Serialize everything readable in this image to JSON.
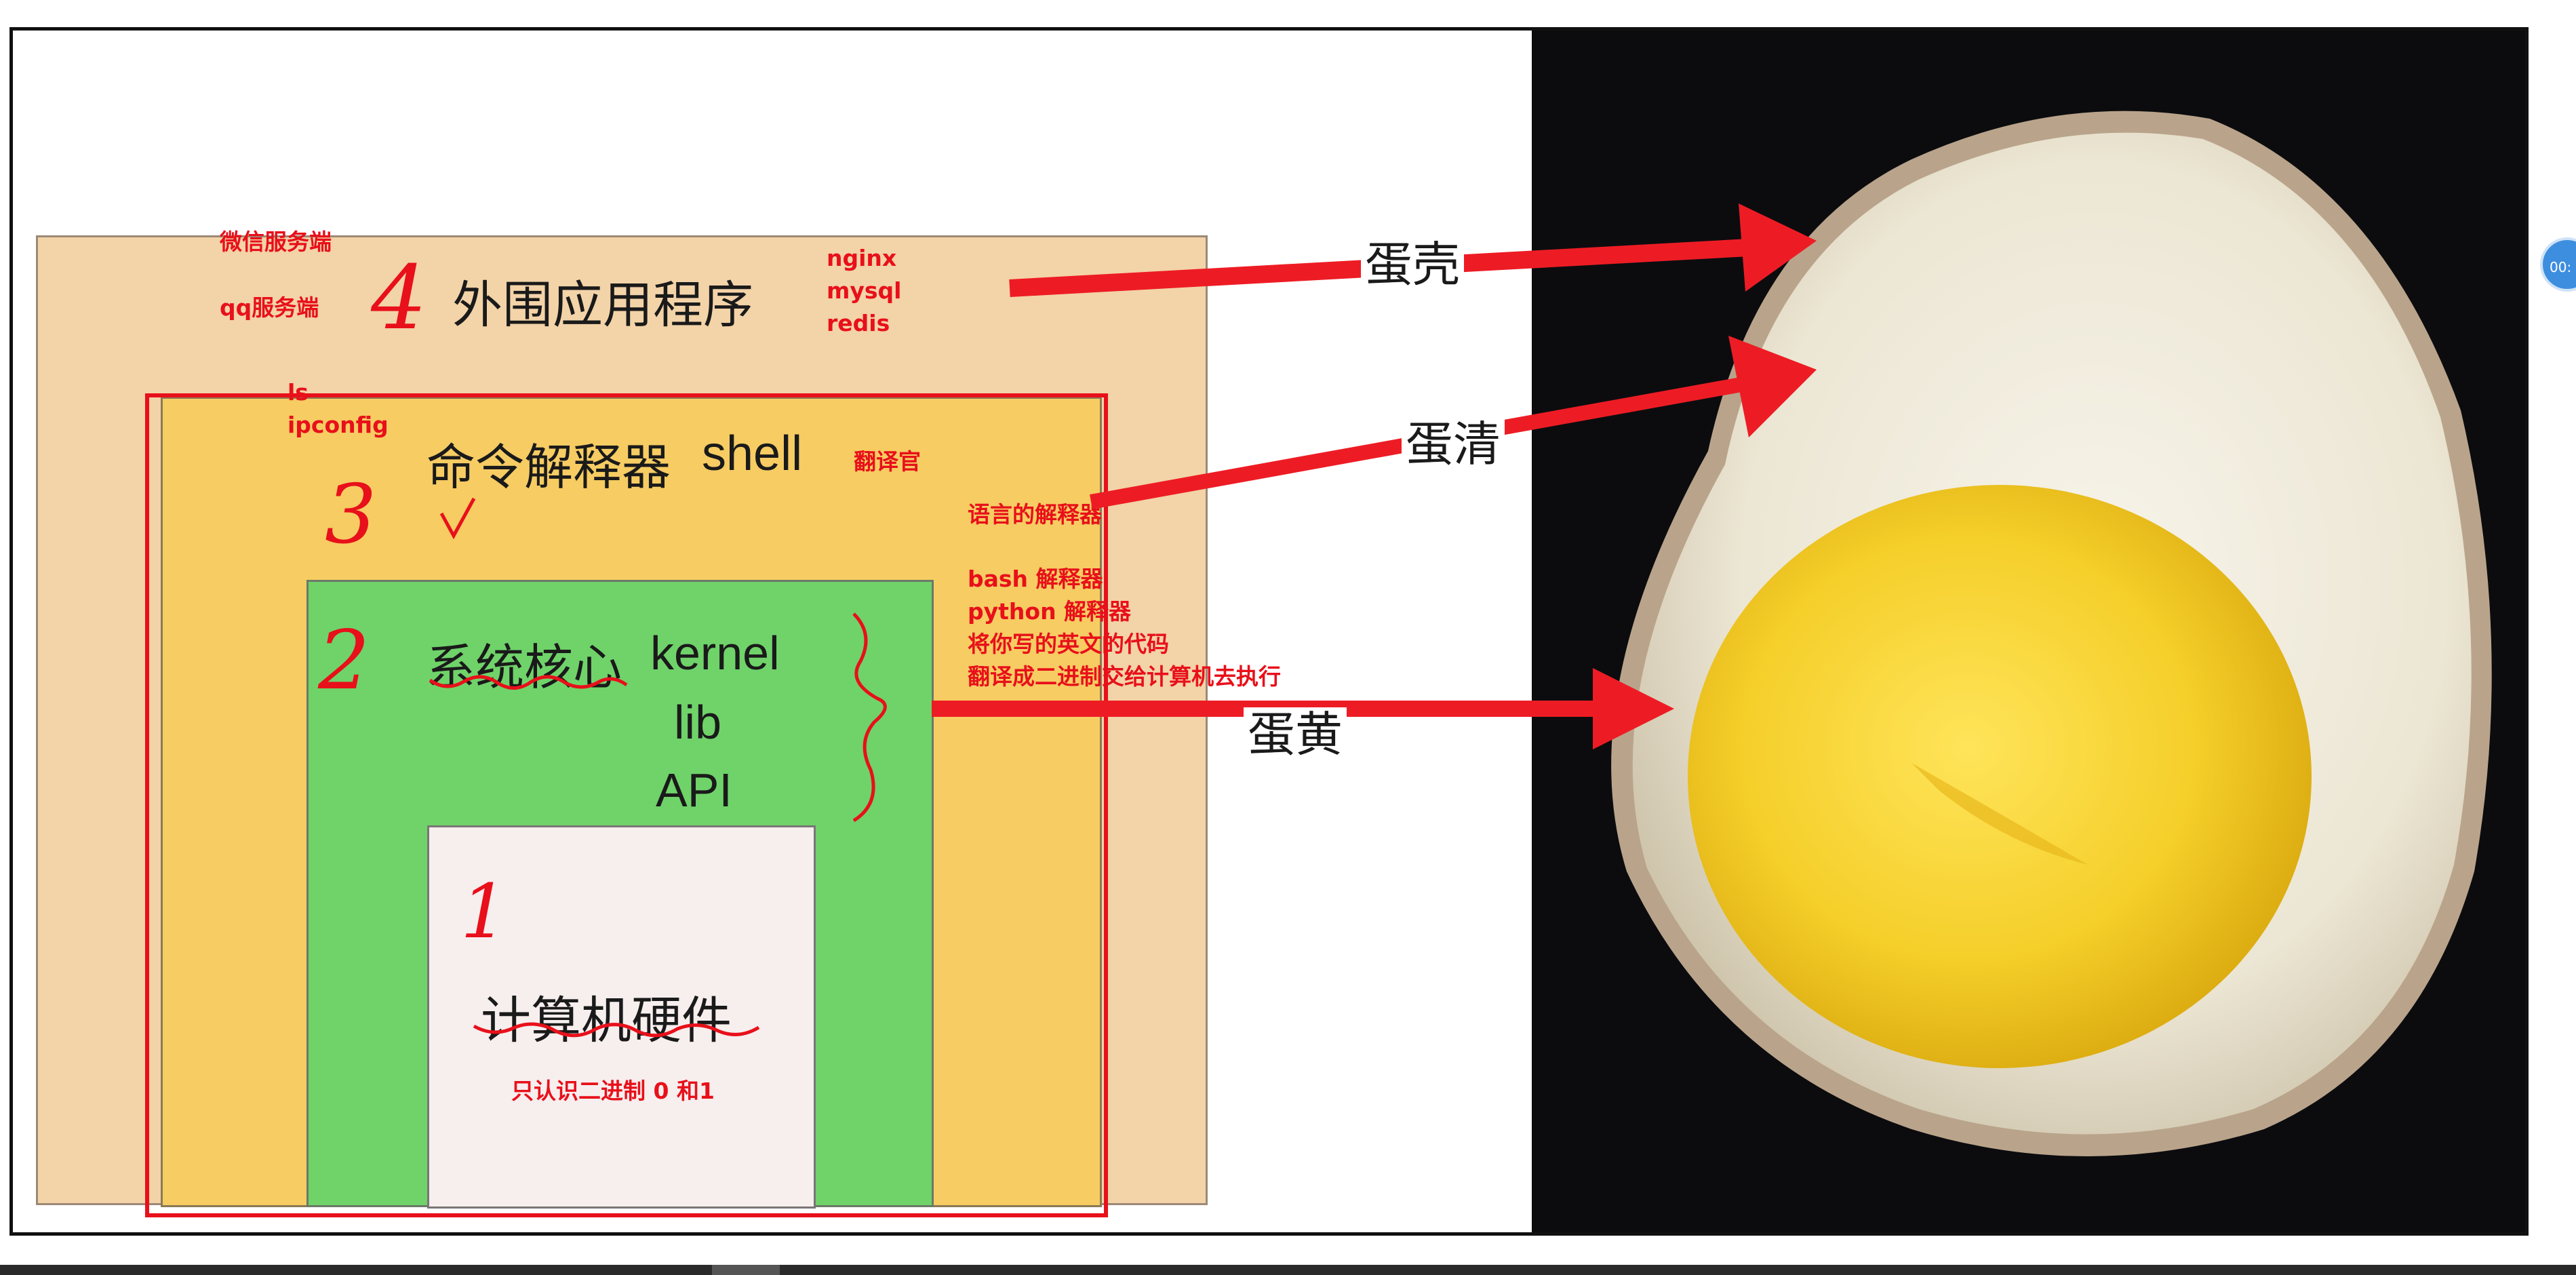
{
  "layers": {
    "layer4": {
      "label": "外围应用程序",
      "number": "4"
    },
    "layer3": {
      "label_cn": "命令解释器",
      "label_en": "shell",
      "number": "3"
    },
    "layer2": {
      "label_cn": "系统核心",
      "label_kernel": "kernel",
      "label_lib": "lib",
      "label_api": "API",
      "number": "2"
    },
    "layer1": {
      "label": "计算机硬件",
      "number": "1"
    }
  },
  "annotations": {
    "wechat_server": "微信服务端",
    "qq_server": "qq服务端",
    "apps": [
      "nginx",
      "mysql",
      "redis"
    ],
    "commands": [
      "ls",
      "ipconfig"
    ],
    "translator": "翻译官",
    "interpreter_intro": "语言的解释器",
    "interpreter_notes": [
      "bash 解释器",
      "python 解释器",
      "将你写的英文的代码",
      "翻译成二进制交给计算机去执行"
    ],
    "binary_only": "只认识二进制 0 和1"
  },
  "egg_labels": {
    "shell": "蛋壳",
    "white": "蛋清",
    "yolk": "蛋黄"
  },
  "side_widget": {
    "text": "00:"
  },
  "colors": {
    "annotation_red": "#e8101a",
    "layer4_bg": "#f3d3a8",
    "layer3_bg": "#f6cc63",
    "layer2_bg": "#6fd36a",
    "layer1_bg": "#f7eeee"
  }
}
